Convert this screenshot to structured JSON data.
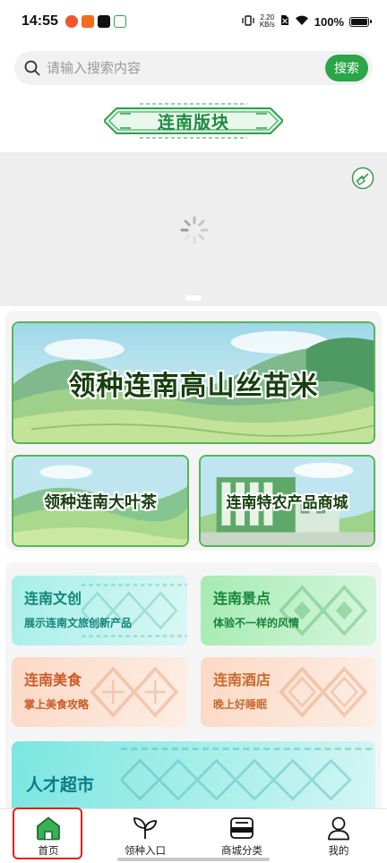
{
  "status_bar": {
    "time": "14:55",
    "net_speed_value": "2.20",
    "net_speed_unit": "KB/s",
    "battery": "100%"
  },
  "search": {
    "placeholder": "请输入搜索内容",
    "button_label": "搜索"
  },
  "section": {
    "title": "连南版块"
  },
  "banners": {
    "main": "领种连南高山丝苗米",
    "left": "领种连南大叶茶",
    "right": "连南特农产品商城"
  },
  "categories": [
    {
      "title": "连南文创",
      "subtitle": "展示连南文旅创新产品"
    },
    {
      "title": "连南景点",
      "subtitle": "体验不一样的风情"
    },
    {
      "title": "连南美食",
      "subtitle": "掌上美食攻略"
    },
    {
      "title": "连南酒店",
      "subtitle": "晚上好睡眠"
    },
    {
      "title": "人才超市"
    }
  ],
  "bottom_nav": [
    {
      "label": "首页",
      "icon": "home-icon",
      "active": true
    },
    {
      "label": "领种入口",
      "icon": "sprout-icon",
      "active": false
    },
    {
      "label": "商城分类",
      "icon": "shop-icon",
      "active": false
    },
    {
      "label": "我的",
      "icon": "user-icon",
      "active": false
    }
  ],
  "colors": {
    "accent": "#2aa547",
    "title_green": "#1e8a43",
    "highlight": "#e02020"
  }
}
